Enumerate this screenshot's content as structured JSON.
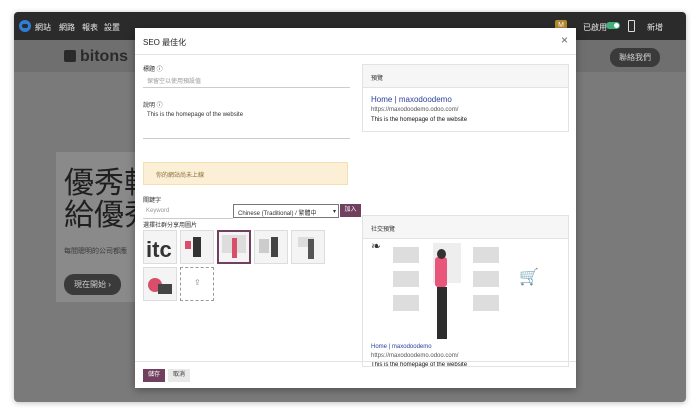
{
  "topbar": {
    "menu": [
      "網站",
      "網路",
      "報表",
      "設置"
    ],
    "avatar": "M",
    "toggle_label": "已啟用",
    "new_label": "新增"
  },
  "site": {
    "brand": "bitons",
    "contact": "聯絡我們",
    "hero_title": "優秀軟\n給優秀",
    "hero_sub": "每間聰明的公司都應",
    "hero_button": "現在開始  ›"
  },
  "modal": {
    "title": "SEO 最佳化",
    "close": "×",
    "fields": {
      "title_label": "標題 ⓘ",
      "title_placeholder": "保留空以使用預設值",
      "desc_label": "說明 ⓘ",
      "desc_value": "This is the homepage of the website"
    },
    "warning": "你的網站尚未上線",
    "keywords": {
      "label": "關鍵字",
      "placeholder": "Keyword",
      "language": "Chinese (Traditional) / 繁體中",
      "add_label": "加入"
    },
    "images_label": "選擇社群分享用圖片",
    "preview": {
      "header": "預覽",
      "title": "Home | maxodoodemo",
      "url": "https://maxodoodemo.odoo.com/",
      "desc": "This is the homepage of the website"
    },
    "social": {
      "header": "社交預覽",
      "title": "Home | maxodoodemo",
      "url": "https://maxodoodemo.odoo.com/",
      "desc": "This is the homepage of the website"
    },
    "footer": {
      "save_label": "儲存",
      "discard_label": "取消"
    }
  },
  "colors": {
    "accent": "#71405f",
    "warning_bg": "#fbefd6",
    "link": "#2b3f9a"
  }
}
